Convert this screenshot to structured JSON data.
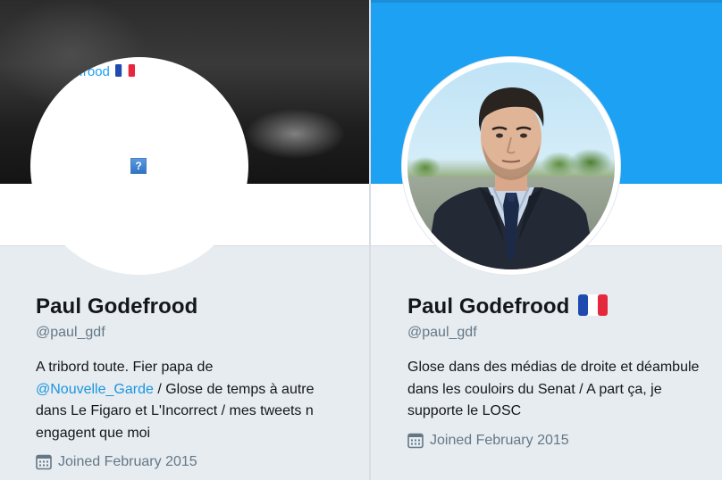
{
  "left_profile": {
    "name": "Paul Godefrood",
    "handle": "@paul_gdf",
    "avatar_alt_text": "defrood",
    "avatar_alt_flag": "flag-france-icon",
    "bio_parts": {
      "p1": "A tribord toute. Fier papa de",
      "mention": "@Nouvelle_Garde",
      "p2": " / Glose de temps à autre dans Le Figaro et L'Incorrect / mes tweets n engagent que moi"
    },
    "joined": "Joined February 2015"
  },
  "right_profile": {
    "name": "Paul Godefrood",
    "name_flag": "flag-france-icon",
    "handle": "@paul_gdf",
    "bio": "Glose dans des médias de droite et déambule dans les couloirs du Senat / A part ça, je supporte le LOSC",
    "joined": "Joined February 2015"
  },
  "colors": {
    "banner_blue": "#1da1f2",
    "link": "#1b95e0",
    "muted": "#657786",
    "background": "#e6ecf0"
  }
}
